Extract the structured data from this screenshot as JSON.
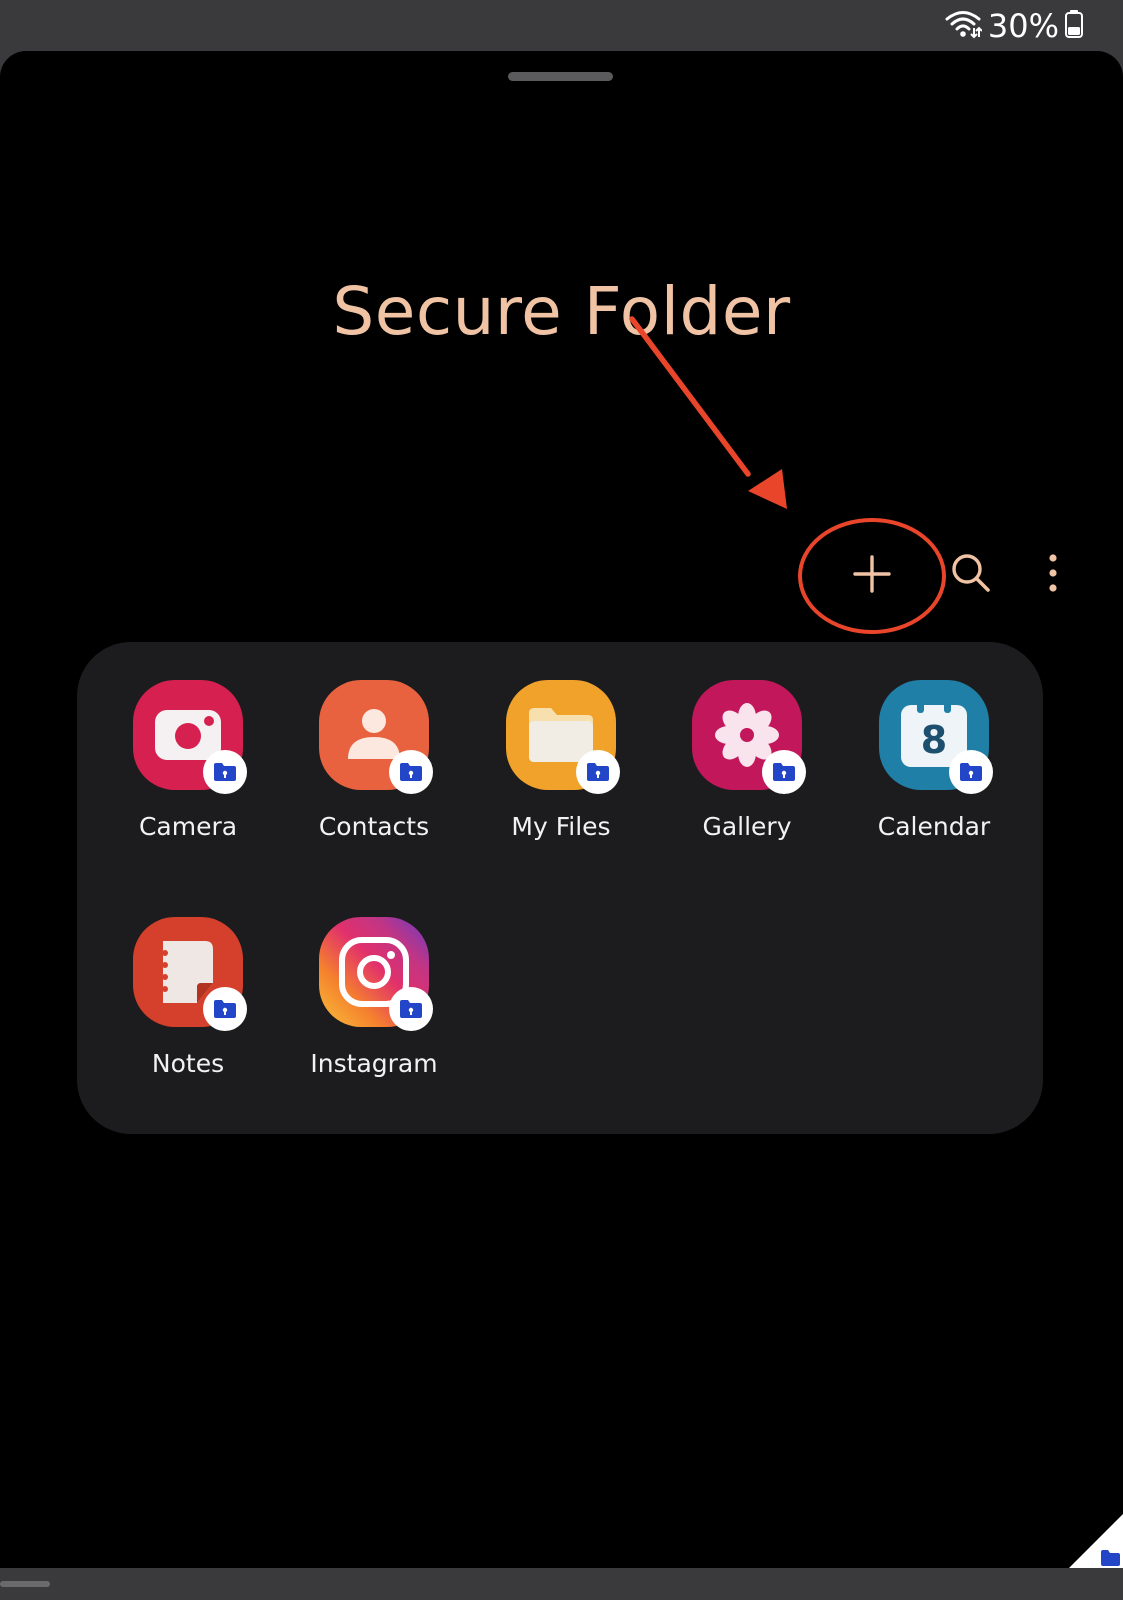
{
  "status_bar": {
    "battery_percent": "30%",
    "wifi_icon": "wifi-icon",
    "battery_icon": "battery-icon"
  },
  "header": {
    "title": "Secure Folder"
  },
  "toolbar": {
    "add_icon": "plus-icon",
    "search_icon": "search-icon",
    "more_icon": "more-vertical-icon"
  },
  "apps": [
    {
      "label": "Camera",
      "icon": "camera-icon",
      "color": "#d6204f"
    },
    {
      "label": "Contacts",
      "icon": "contacts-icon",
      "color": "#e8623f"
    },
    {
      "label": "My Files",
      "icon": "folder-icon",
      "color": "#f0a22a"
    },
    {
      "label": "Gallery",
      "icon": "flower-icon",
      "color": "#c2185b"
    },
    {
      "label": "Calendar",
      "icon": "calendar-icon",
      "color": "#1f7fa6",
      "calendar_day": "8"
    },
    {
      "label": "Notes",
      "icon": "notes-icon",
      "color": "#d5402c"
    },
    {
      "label": "Instagram",
      "icon": "instagram-icon",
      "color": "#c13584"
    }
  ],
  "colors": {
    "title": "#efc3a4",
    "panel": "#1c1c1e",
    "annotation": "#e8452a",
    "badge": "#2346c9"
  }
}
